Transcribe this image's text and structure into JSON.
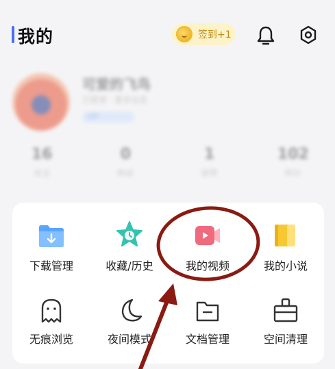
{
  "header": {
    "title": "我的",
    "signin_label": "签到+1"
  },
  "profile": {
    "nickname": "可爱的飞鸟",
    "subline": "已登录 · 更多信息",
    "vip_label": "VIP",
    "stats": [
      {
        "value": "16",
        "label": "关注"
      },
      {
        "value": "0",
        "label": "粉丝"
      },
      {
        "value": "1",
        "label": "获赞"
      },
      {
        "value": "102",
        "label": "积分"
      }
    ]
  },
  "tools": {
    "row1": [
      {
        "label": "下载管理",
        "icon": "folder-download-icon"
      },
      {
        "label": "收藏/历史",
        "icon": "star-clock-icon"
      },
      {
        "label": "我的视频",
        "icon": "video-icon"
      },
      {
        "label": "我的小说",
        "icon": "book-icon"
      }
    ],
    "row2": [
      {
        "label": "无痕浏览",
        "icon": "ghost-icon"
      },
      {
        "label": "夜间模式",
        "icon": "moon-icon"
      },
      {
        "label": "文档管理",
        "icon": "folder-icon"
      },
      {
        "label": "空间清理",
        "icon": "broom-icon"
      }
    ]
  },
  "colors": {
    "accent": "#4a6cf7",
    "annotation": "#8b1a12",
    "video_icon": "#f06a7e",
    "star_icon": "#33c3b0",
    "folder_blue": "#5aa5ff",
    "book_yellow": "#f7c832"
  }
}
